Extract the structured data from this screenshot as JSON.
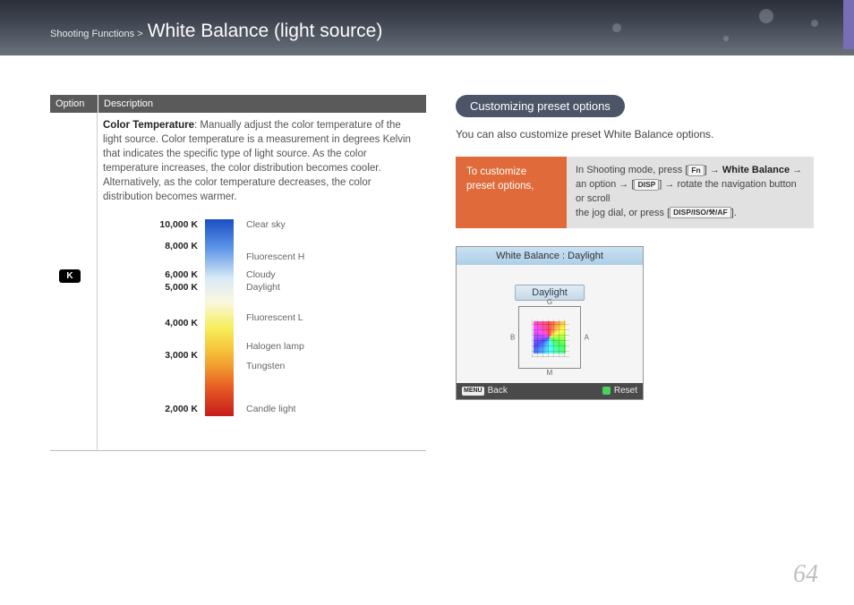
{
  "header": {
    "breadcrumb_prefix": "Shooting Functions >",
    "page_title": "White Balance (light source)"
  },
  "option_table": {
    "th_option": "Option",
    "th_desc": "Description",
    "icon_label": "K",
    "desc_bold": "Color Temperature",
    "desc_text": ": Manually adjust the color temperature of the light source. Color temperature is a measurement in degrees Kelvin that indicates the specific type of light source. As the color temperature increases, the color distribution becomes cooler. Alternatively, as the color temperature decreases, the color distribution becomes warmer."
  },
  "ct_labels": [
    {
      "k": "10,000 K",
      "pos": 0
    },
    {
      "k": "8,000 K",
      "pos": 24
    },
    {
      "k": "6,000 K",
      "pos": 56
    },
    {
      "k": "5,000 K",
      "pos": 70
    },
    {
      "k": "4,000 K",
      "pos": 110
    },
    {
      "k": "3,000 K",
      "pos": 146
    },
    {
      "k": "2,000 K",
      "pos": 206
    }
  ],
  "ct_names": [
    {
      "n": "Clear sky",
      "pos": 0
    },
    {
      "n": "Fluorescent H",
      "pos": 36
    },
    {
      "n": "Cloudy",
      "pos": 56
    },
    {
      "n": "Daylight",
      "pos": 70
    },
    {
      "n": "Fluorescent L",
      "pos": 104
    },
    {
      "n": "Halogen lamp",
      "pos": 136
    },
    {
      "n": "Tungsten",
      "pos": 158
    },
    {
      "n": "Candle light",
      "pos": 206
    }
  ],
  "right": {
    "section_title": "Customizing preset options",
    "intro": "You can also customize preset White Balance options.",
    "instr_left": "To customize preset options,",
    "instr_r1a": "In Shooting mode, press [",
    "instr_fn": "Fn",
    "instr_r1b": "] → ",
    "instr_wb": "White Balance",
    "instr_r1c": " →",
    "instr_r2a": "an option → [",
    "instr_disp": "DISP",
    "instr_r2b": "] → rotate the navigation button or scroll",
    "instr_r3a": "the jog dial, or press [",
    "instr_btns": "DISP/ISO/⚒/AF",
    "instr_r3b": "]."
  },
  "wb_screen": {
    "title": "White Balance : Daylight",
    "mode": "Daylight",
    "axis_g": "G",
    "axis_m": "M",
    "axis_b": "B",
    "axis_a": "A",
    "menu": "MENU",
    "back": "Back",
    "reset": "Reset"
  },
  "page_number": "64"
}
